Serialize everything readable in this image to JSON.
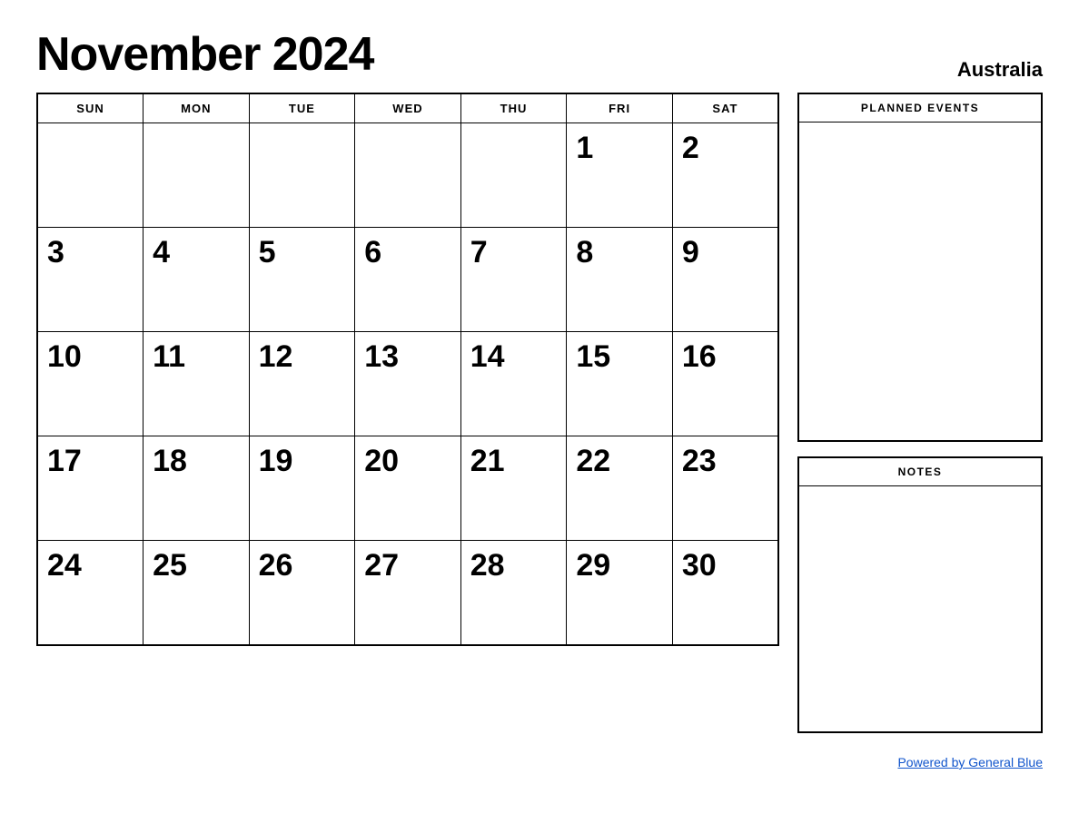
{
  "header": {
    "title": "November 2024",
    "country": "Australia"
  },
  "calendar": {
    "days_of_week": [
      "SUN",
      "MON",
      "TUE",
      "WED",
      "THU",
      "FRI",
      "SAT"
    ],
    "weeks": [
      [
        "",
        "",
        "",
        "",
        "",
        "1",
        "2"
      ],
      [
        "3",
        "4",
        "5",
        "6",
        "7",
        "8",
        "9"
      ],
      [
        "10",
        "11",
        "12",
        "13",
        "14",
        "15",
        "16"
      ],
      [
        "17",
        "18",
        "19",
        "20",
        "21",
        "22",
        "23"
      ],
      [
        "24",
        "25",
        "26",
        "27",
        "28",
        "29",
        "30"
      ]
    ]
  },
  "sidebar": {
    "planned_events_label": "PLANNED EVENTS",
    "notes_label": "NOTES"
  },
  "footer": {
    "powered_by": "Powered by General Blue"
  }
}
